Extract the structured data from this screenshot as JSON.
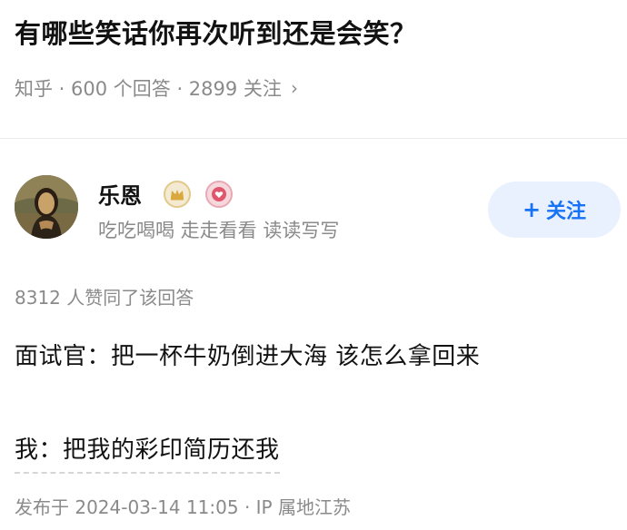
{
  "question": {
    "title": "有哪些笑话你再次听到还是会笑？",
    "meta": "知乎 · 600 个回答 · 2899 关注",
    "meta_chevron": "›"
  },
  "author": {
    "name": "乐恩",
    "bio": "吃吃喝喝 走走看看 读读写写",
    "avatar_icon": "mona-lisa-avatar",
    "badges": [
      "crown-badge-icon",
      "heart-badge-icon"
    ]
  },
  "follow_button": {
    "plus": "+",
    "label": "关注"
  },
  "answer": {
    "vote_count": "8312 人赞同了该回答",
    "lines": [
      "面试官：把一杯牛奶倒进大海 该怎么拿回来",
      "我：把我的彩印简历还我"
    ],
    "publish_info": "发布于 2024-03-14 11:05 · IP 属地江苏"
  },
  "colors": {
    "accent": "#1772f6",
    "follow_bg": "#e8f1fd",
    "muted_text": "#8a8a8a",
    "primary_text": "#121212"
  }
}
